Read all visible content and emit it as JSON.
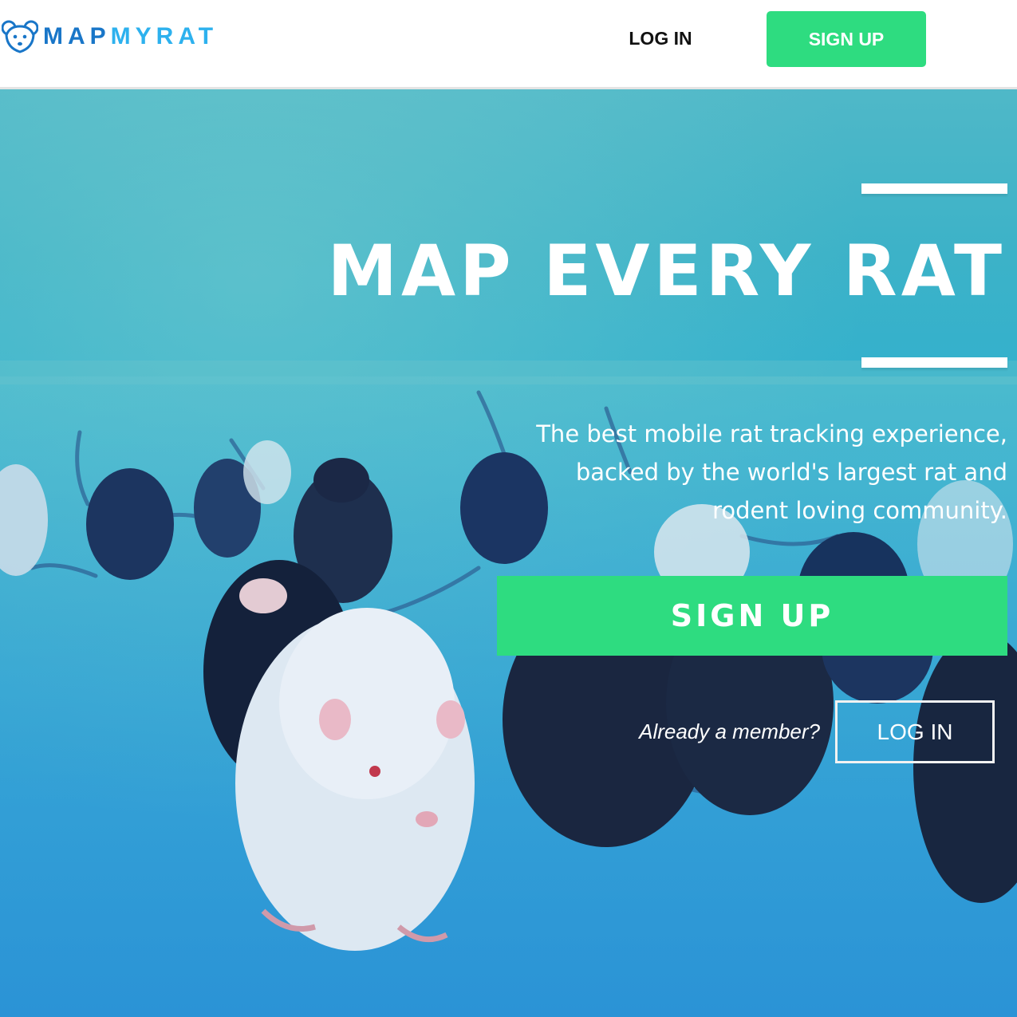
{
  "colors": {
    "accent_green": "#2edc80",
    "logo_dark_blue": "#1976c8",
    "logo_light_blue": "#2db1ee",
    "hero_tint": "#2fb0cf"
  },
  "header": {
    "logo": {
      "icon": "rat-head-icon",
      "text_part1": "MAP",
      "text_part2": "MY",
      "text_part3": "RAT"
    },
    "login_label": "LOG IN",
    "signup_label": "SIGN UP"
  },
  "hero": {
    "background_image": "rats-on-blue-surface-photo",
    "headline": "MAP EVERY RAT",
    "tagline_lines": [
      "The best mobile rat tracking experience,",
      "backed by the world's largest rat and",
      "rodent loving community."
    ],
    "signup_label": "SIGN UP",
    "already_member": "Already a member?",
    "login_label": "LOG IN"
  }
}
